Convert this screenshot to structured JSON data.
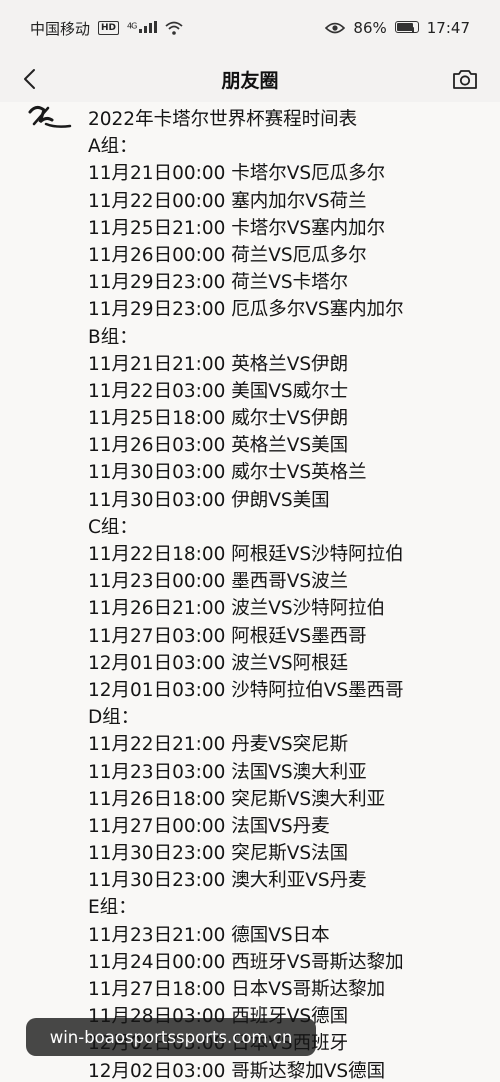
{
  "status_bar": {
    "carrier": "中国移动",
    "hd": "HD",
    "network": "4G",
    "battery_percent": "86%",
    "time": "17:47"
  },
  "nav": {
    "title": "朋友圈"
  },
  "post": {
    "lines": [
      "2022年卡塔尔世界杯赛程时间表",
      "A组：",
      "11月21日00:00 卡塔尔VS厄瓜多尔",
      "11月22日00:00 塞内加尔VS荷兰",
      "11月25日21:00 卡塔尔VS塞内加尔",
      "11月26日00:00 荷兰VS厄瓜多尔",
      "11月29日23:00 荷兰VS卡塔尔",
      "11月29日23:00 厄瓜多尔VS塞内加尔",
      "B组：",
      "11月21日21:00 英格兰VS伊朗",
      "11月22日03:00 美国VS威尔士",
      "11月25日18:00 威尔士VS伊朗",
      "11月26日03:00 英格兰VS美国",
      "11月30日03:00 威尔士VS英格兰",
      "11月30日03:00 伊朗VS美国",
      "C组：",
      "11月22日18:00 阿根廷VS沙特阿拉伯",
      "11月23日00:00 墨西哥VS波兰",
      "11月26日21:00 波兰VS沙特阿拉伯",
      "11月27日03:00 阿根廷VS墨西哥",
      "12月01日03:00 波兰VS阿根廷",
      "12月01日03:00 沙特阿拉伯VS墨西哥",
      "D组：",
      "11月22日21:00 丹麦VS突尼斯",
      "11月23日03:00 法国VS澳大利亚",
      "11月26日18:00 突尼斯VS澳大利亚",
      "11月27日00:00 法国VS丹麦",
      "11月30日23:00 突尼斯VS法国",
      "11月30日23:00 澳大利亚VS丹麦",
      "E组：",
      "11月23日21:00 德国VS日本",
      "11月24日00:00 西班牙VS哥斯达黎加",
      "11月27日18:00 日本VS哥斯达黎加",
      "11月28日03:00 西班牙VS德国",
      "12月02日03:00 日本VS西班牙",
      "12月02日03:00 哥斯达黎加VS德国"
    ]
  },
  "watermark": {
    "text": "win-boaosportssports.com.cn"
  },
  "icons": {
    "back": "back-arrow-icon",
    "camera": "camera-icon",
    "eye": "eye-icon",
    "wifi": "wifi-icon",
    "signal": "signal-icon",
    "battery": "battery-icon"
  }
}
